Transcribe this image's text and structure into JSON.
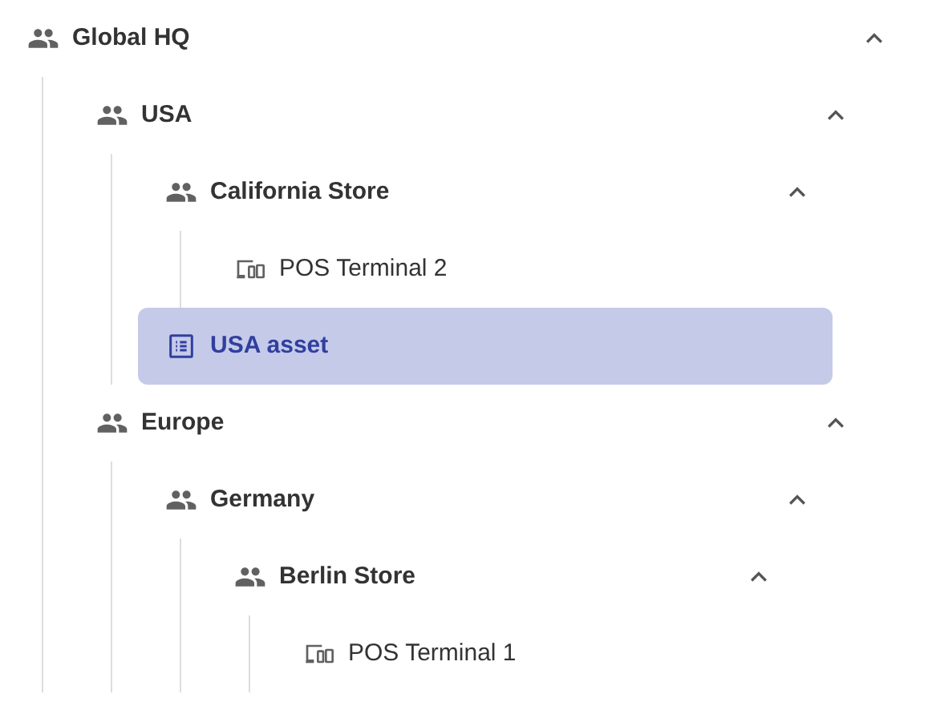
{
  "tree": [
    {
      "label": "Global HQ",
      "kind": "group",
      "expanded": true,
      "selected": false,
      "children": [
        {
          "label": "USA",
          "kind": "group",
          "expanded": true,
          "selected": false,
          "children": [
            {
              "label": "California Store",
              "kind": "group",
              "expanded": true,
              "selected": false,
              "children": [
                {
                  "label": "POS Terminal 2",
                  "kind": "device",
                  "selected": false
                }
              ]
            },
            {
              "label": "USA asset",
              "kind": "asset",
              "selected": true
            }
          ]
        },
        {
          "label": "Europe",
          "kind": "group",
          "expanded": true,
          "selected": false,
          "children": [
            {
              "label": "Germany",
              "kind": "group",
              "expanded": true,
              "selected": false,
              "children": [
                {
                  "label": "Berlin Store",
                  "kind": "group",
                  "expanded": true,
                  "selected": false,
                  "children": [
                    {
                      "label": "POS Terminal 1",
                      "kind": "device",
                      "selected": false
                    }
                  ]
                }
              ]
            }
          ]
        }
      ]
    }
  ]
}
